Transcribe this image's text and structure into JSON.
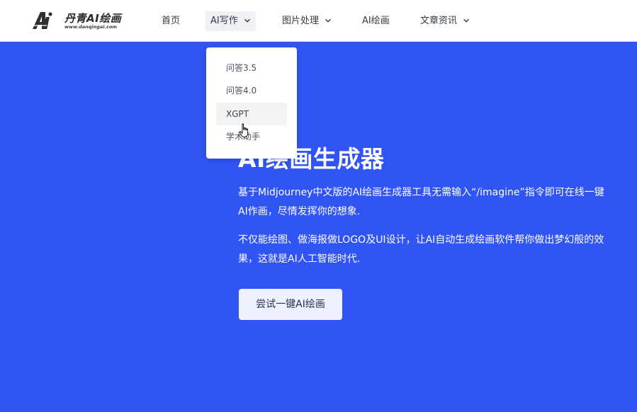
{
  "brand": {
    "name": "丹青AI绘画",
    "url": "www.danqingai.com",
    "mark": "Ai",
    "accent": "#3154f5"
  },
  "nav": {
    "items": [
      {
        "label": "首页",
        "has_dropdown": false
      },
      {
        "label": "AI写作",
        "has_dropdown": true,
        "active": true
      },
      {
        "label": "图片处理",
        "has_dropdown": true
      },
      {
        "label": "AI绘画",
        "has_dropdown": false
      },
      {
        "label": "文章资讯",
        "has_dropdown": true
      }
    ],
    "icons": {
      "dropdown": "chevron-down-icon"
    }
  },
  "dropdown": {
    "items": [
      {
        "label": "问答3.5"
      },
      {
        "label": "问答4.0"
      },
      {
        "label": "XGPT",
        "hovered": true
      },
      {
        "label": "学术助手"
      }
    ]
  },
  "hero": {
    "title": "AI绘画生成器",
    "paragraph1": "基于Midjourney中文版的AI绘画生成器工具无需输入“/imagine”指令即可在线一键AI作画，尽情发挥你的想象.",
    "paragraph2": "不仅能绘图、做海报做LOGO及UI设计，让AI自动生成绘画软件帮你做出梦幻般的效果，这就是AI人工智能时代.",
    "cta_label": "尝试一键AI绘画"
  },
  "cursor": {
    "icon": "hand-pointer-icon"
  }
}
